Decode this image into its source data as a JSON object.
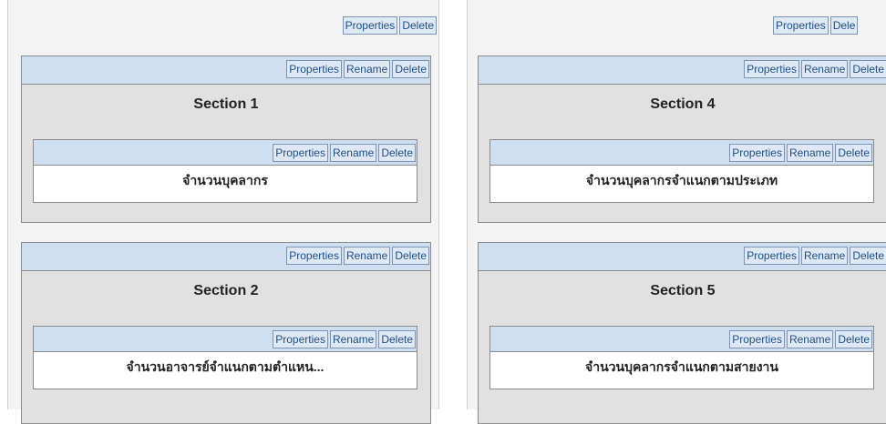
{
  "buttons": {
    "properties": "Properties",
    "rename": "Rename",
    "delete": "Delete",
    "delete_clipped": "Dele"
  },
  "sections": [
    {
      "title": "Section 1",
      "item": "จำนวนบุคลากร"
    },
    {
      "title": "Section 2",
      "item": "จำนวนอาจารย์จำแนกตามตำแหน..."
    },
    {
      "title": "Section 4",
      "item": "จำนวนบุคลากรจำแนกตามประเภท"
    },
    {
      "title": "Section 5",
      "item": "จำนวนบุคลากรจำแนกตามสายงาน"
    }
  ]
}
